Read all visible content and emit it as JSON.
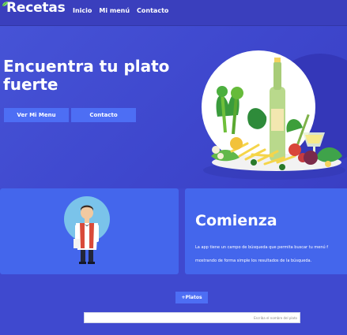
{
  "header": {
    "brand": "Recetas",
    "nav": [
      "Inicio",
      "Mi menú",
      "Contacto"
    ]
  },
  "hero": {
    "title": "Encuentra tu plato fuerte",
    "buttons": [
      "Ver Mi Menu",
      "Contacto"
    ],
    "illustration": "salad-plate-with-wine-bottle"
  },
  "card_left": {
    "illustration": "waiter-icon"
  },
  "card_right": {
    "title": "Comienza",
    "text_line1": "La app tiene un campo de búsqueda que permita buscar tu menú f",
    "text_line2": "mostrando de forma simple los resultados de la búsqueda."
  },
  "search": {
    "button_label": "+Platos",
    "placeholder": "Escriba el nombre del plato"
  },
  "colors": {
    "background": "#3f49cf",
    "topbar": "#3a3fbd",
    "accent_button": "#4d6ef4",
    "card": "#4466ec"
  }
}
